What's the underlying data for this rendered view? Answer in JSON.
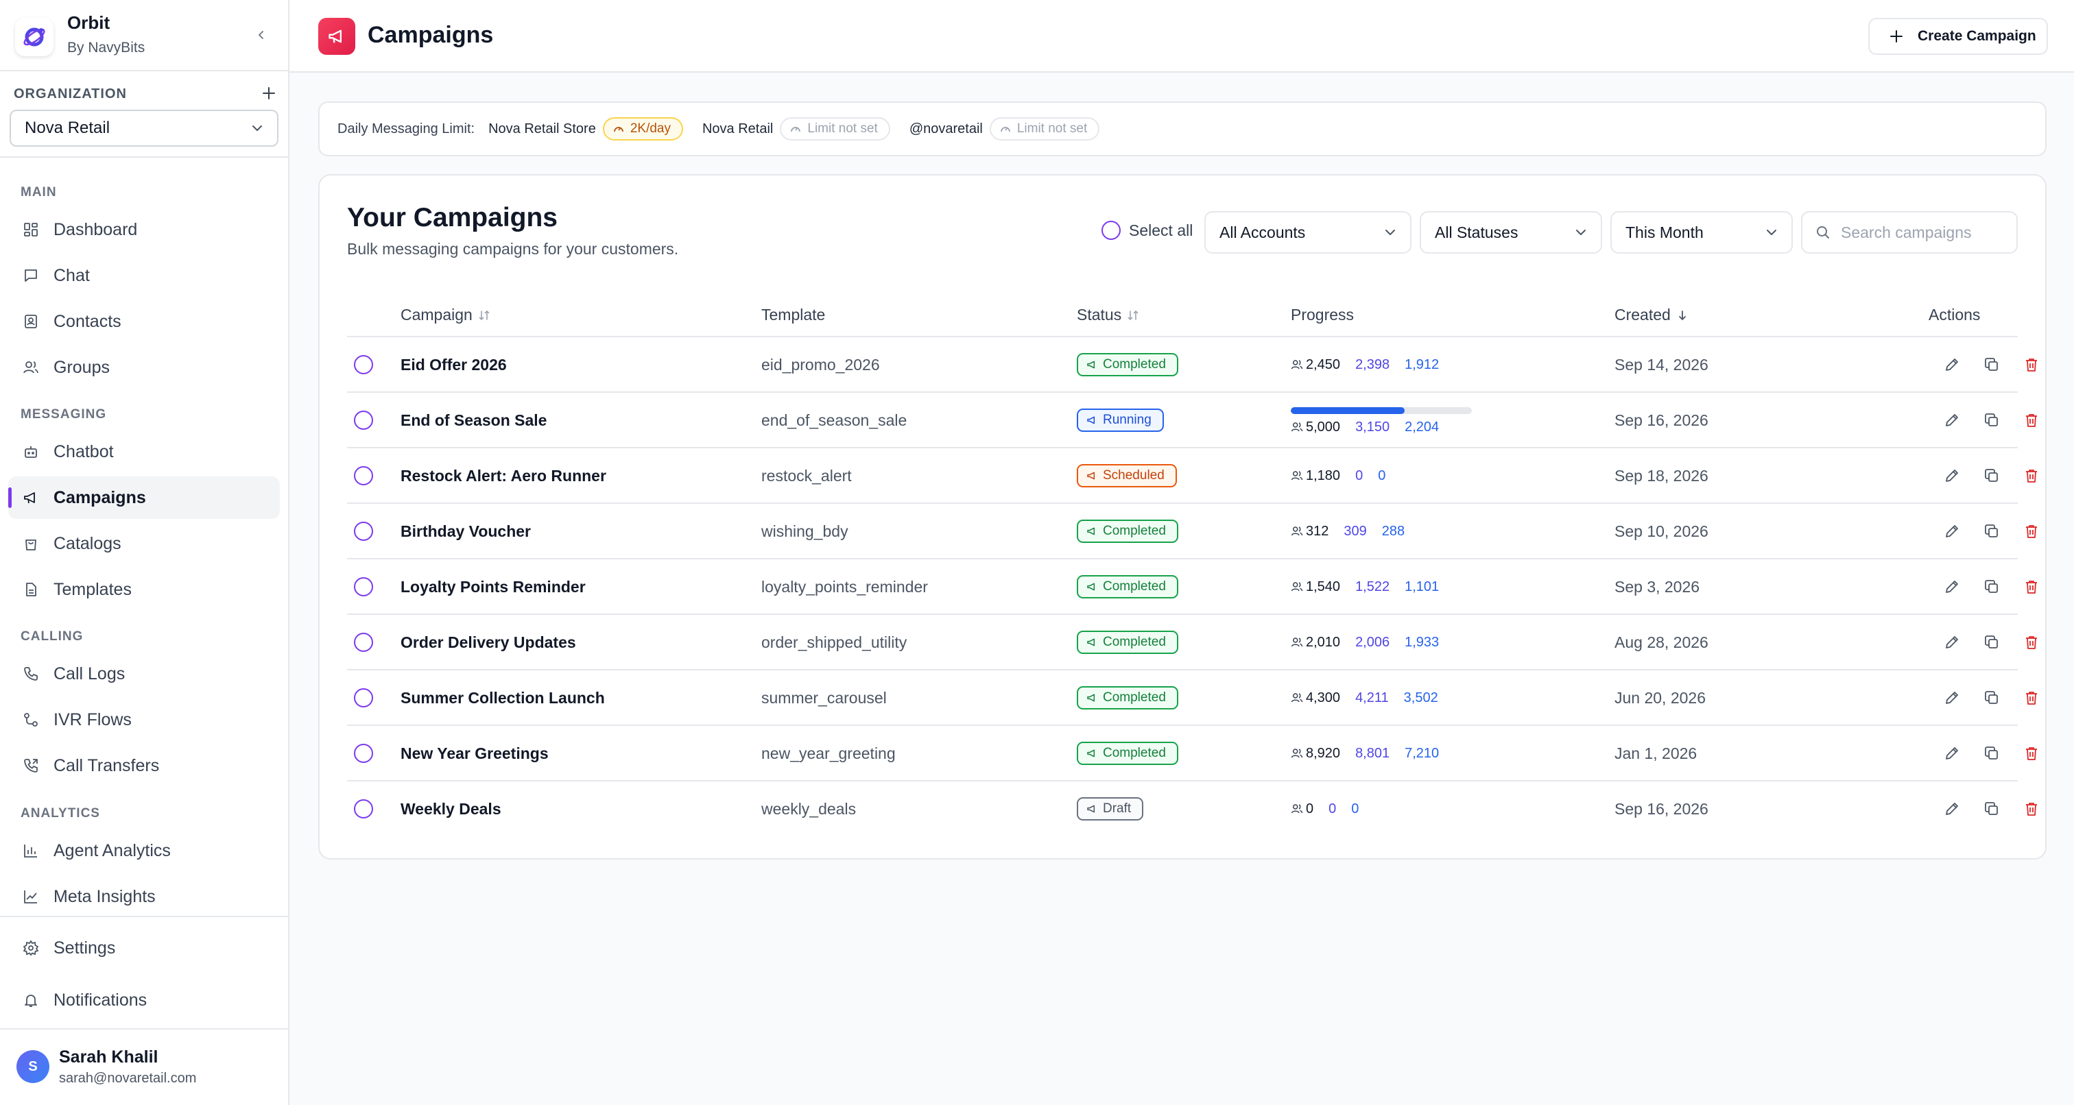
{
  "brand": {
    "name": "Orbit",
    "sub": "By NavyBits"
  },
  "organization": {
    "label": "ORGANIZATION",
    "selected": "Nova Retail"
  },
  "nav": {
    "main_label": "MAIN",
    "messaging_label": "MESSAGING",
    "calling_label": "CALLING",
    "analytics_label": "ANALYTICS",
    "items": {
      "dashboard": "Dashboard",
      "chat": "Chat",
      "contacts": "Contacts",
      "groups": "Groups",
      "chatbot": "Chatbot",
      "campaigns": "Campaigns",
      "catalogs": "Catalogs",
      "templates": "Templates",
      "call_logs": "Call Logs",
      "ivr_flows": "IVR Flows",
      "call_transfers": "Call Transfers",
      "agent_analytics": "Agent Analytics",
      "meta_insights": "Meta Insights",
      "settings": "Settings",
      "notifications": "Notifications"
    },
    "active": "campaigns"
  },
  "user": {
    "initial": "S",
    "name": "Sarah Khalil",
    "email": "sarah@novaretail.com"
  },
  "header": {
    "title": "Campaigns",
    "create_label": "Create Campaign"
  },
  "limits": {
    "label": "Daily Messaging Limit:",
    "accounts": [
      {
        "name": "Nova Retail Store",
        "limit": "2K/day"
      },
      {
        "name": "Nova Retail",
        "limit": "Limit not set"
      },
      {
        "name": "@novaretail",
        "limit": "Limit not set"
      }
    ]
  },
  "campaigns_card": {
    "title": "Your Campaigns",
    "subtitle": "Bulk messaging campaigns for your customers.",
    "select_all": "Select all",
    "filters": {
      "accounts": "All Accounts",
      "statuses": "All Statuses",
      "period": "This Month"
    },
    "search_placeholder": "Search campaigns",
    "columns": {
      "campaign": "Campaign",
      "template": "Template",
      "status": "Status",
      "progress": "Progress",
      "created": "Created",
      "actions": "Actions"
    },
    "rows": [
      {
        "name": "Eid Offer 2026",
        "template": "eid_promo_2026",
        "status": "Completed",
        "total": "2,450",
        "sent": "2,398",
        "read": "1,912",
        "created": "Sep 14, 2026"
      },
      {
        "name": "End of Season Sale",
        "template": "end_of_season_sale",
        "status": "Running",
        "total": "5,000",
        "sent": "3,150",
        "read": "2,204",
        "progress_fraction": 0.63,
        "created": "Sep 16, 2026"
      },
      {
        "name": "Restock Alert: Aero Runner",
        "template": "restock_alert",
        "status": "Scheduled",
        "total": "1,180",
        "sent": "0",
        "read": "0",
        "created": "Sep 18, 2026"
      },
      {
        "name": "Birthday Voucher",
        "template": "wishing_bdy",
        "status": "Completed",
        "total": "312",
        "sent": "309",
        "read": "288",
        "created": "Sep 10, 2026"
      },
      {
        "name": "Loyalty Points Reminder",
        "template": "loyalty_points_reminder",
        "status": "Completed",
        "total": "1,540",
        "sent": "1,522",
        "read": "1,101",
        "created": "Sep 3, 2026"
      },
      {
        "name": "Order Delivery Updates",
        "template": "order_shipped_utility",
        "status": "Completed",
        "total": "2,010",
        "sent": "2,006",
        "read": "1,933",
        "created": "Aug 28, 2026"
      },
      {
        "name": "Summer Collection Launch",
        "template": "summer_carousel",
        "status": "Completed",
        "total": "4,300",
        "sent": "4,211",
        "read": "3,502",
        "created": "Jun 20, 2026"
      },
      {
        "name": "New Year Greetings",
        "template": "new_year_greeting",
        "status": "Completed",
        "total": "8,920",
        "sent": "8,801",
        "read": "7,210",
        "created": "Jan 1, 2026"
      },
      {
        "name": "Weekly Deals",
        "template": "weekly_deals",
        "status": "Draft",
        "total": "0",
        "sent": "0",
        "read": "0",
        "created": "Sep 16, 2026"
      }
    ]
  },
  "colors": {
    "accent": "#7c3aed",
    "page_icon": "#e11d48",
    "completed": "#16a34a",
    "running": "#2563eb",
    "scheduled": "#ea580c",
    "draft": "#6b7280",
    "delete": "#dc2626"
  }
}
